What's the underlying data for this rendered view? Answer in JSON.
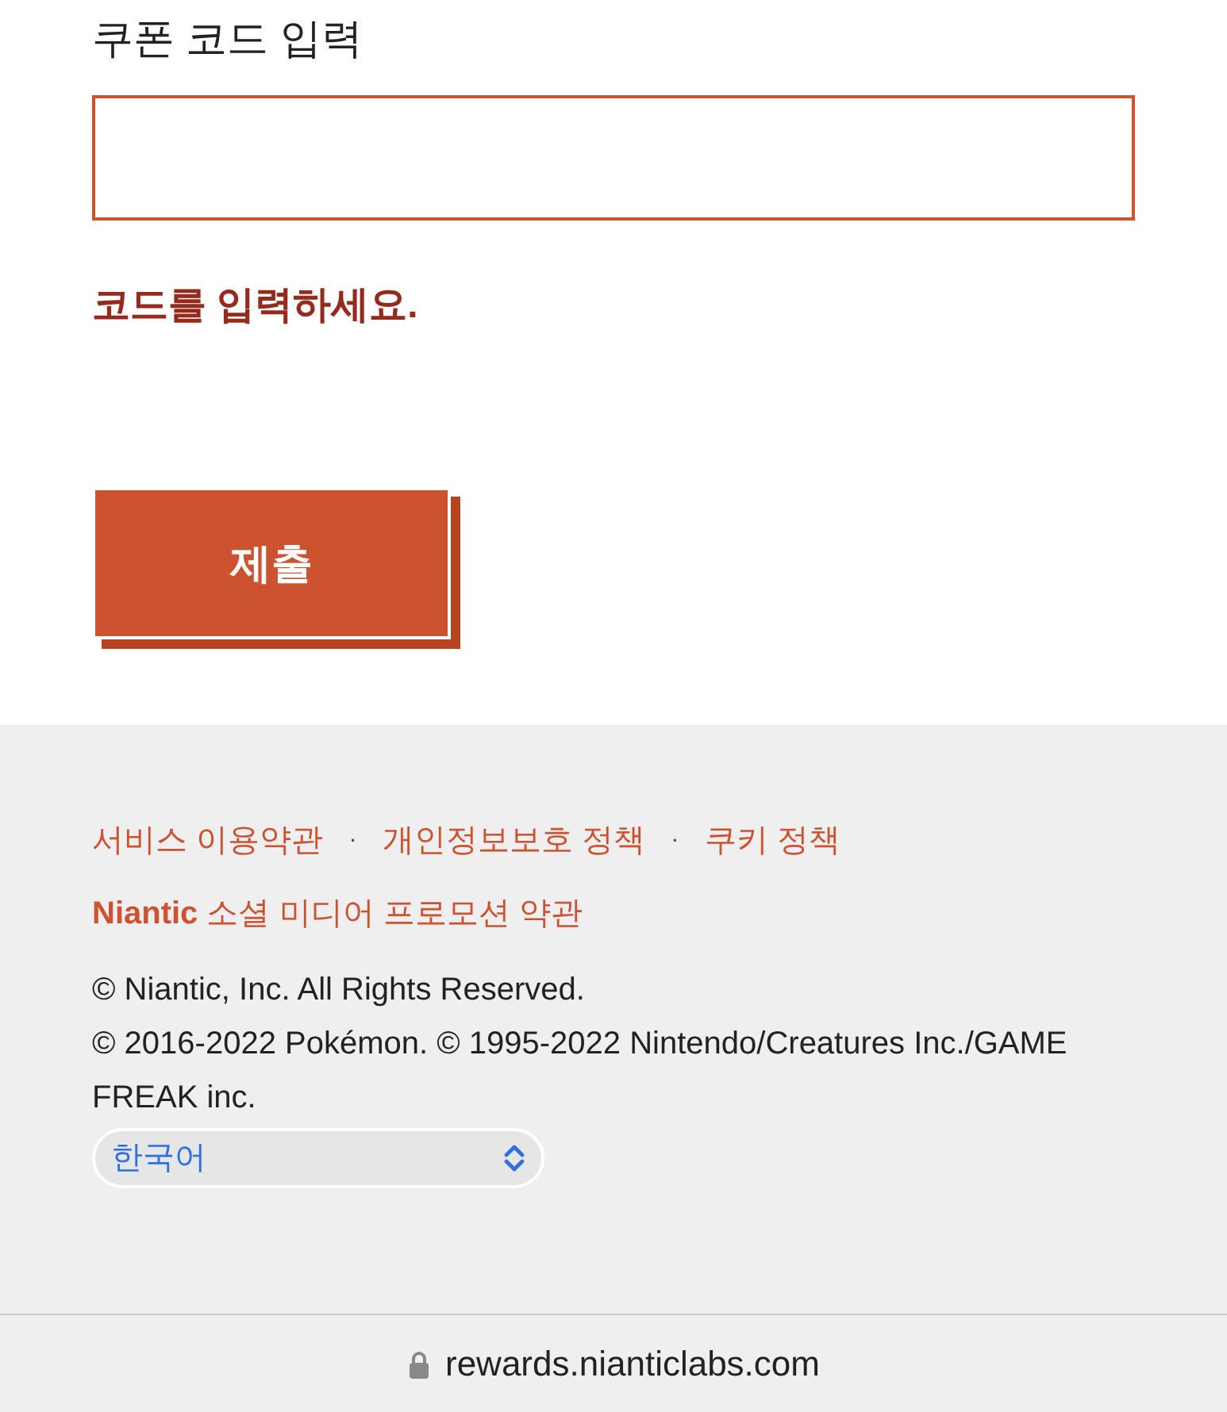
{
  "coupon_form": {
    "label": "쿠폰 코드 입력",
    "error": "코드를 입력하세요.",
    "submit": "제출"
  },
  "footer": {
    "links": [
      "서비스 이용약관",
      "개인정보보호 정책",
      "쿠키 정책"
    ],
    "separator": "·",
    "promo_link": "**Niantic** 소셜 미디어 프로모션 약관",
    "copyrights": [
      "© Niantic, Inc. All Rights Reserved.",
      "© 2016-2022 Pokémon. © 1995-2022 Nintendo/Creatures Inc./GAME FREAK inc."
    ],
    "language": "한국어"
  },
  "address_bar": {
    "url": "rewards.nianticlabs.com"
  }
}
